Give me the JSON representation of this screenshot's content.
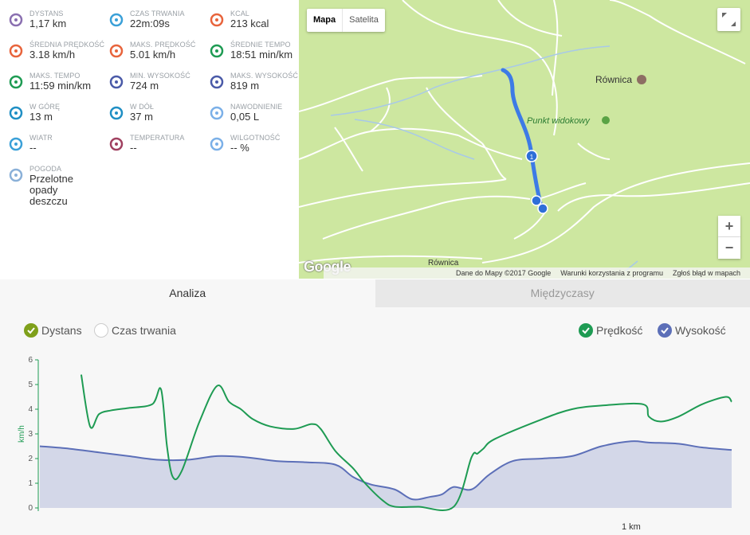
{
  "stats": [
    {
      "label": "DYSTANS",
      "value": "1,17 km",
      "icon": "distance-pin-icon"
    },
    {
      "label": "CZAS TRWANIA",
      "value": "22m:09s",
      "icon": "stopwatch-icon"
    },
    {
      "label": "KCAL",
      "value": "213 kcal",
      "icon": "flame-icon"
    },
    {
      "label": "ŚREDNIA PRĘDKOŚĆ",
      "value": "3.18 km/h",
      "icon": "speedometer-icon"
    },
    {
      "label": "MAKS. PRĘDKOŚĆ",
      "value": "5.01 km/h",
      "icon": "speedometer-max-icon"
    },
    {
      "label": "ŚREDNIE TEMPO",
      "value": "18:51 min/km",
      "icon": "pace-icon"
    },
    {
      "label": "MAKS. TEMPO",
      "value": "11:59 min/km",
      "icon": "pace-max-icon"
    },
    {
      "label": "MIN. WYSOKOŚĆ",
      "value": "724 m",
      "icon": "mountain-min-icon"
    },
    {
      "label": "MAKS. WYSOKOŚĆ",
      "value": "819 m",
      "icon": "mountain-max-icon"
    },
    {
      "label": "W GÓRĘ",
      "value": "13 m",
      "icon": "ascent-icon"
    },
    {
      "label": "W DÓŁ",
      "value": "37 m",
      "icon": "descent-icon"
    },
    {
      "label": "NAWODNIENIE",
      "value": "0,05 L",
      "icon": "water-drops-icon"
    },
    {
      "label": "WIATR",
      "value": "--",
      "icon": "wind-icon"
    },
    {
      "label": "TEMPERATURA",
      "value": "--",
      "icon": "thermometer-icon"
    },
    {
      "label": "WILGOTNOŚĆ",
      "value": "-- %",
      "icon": "humidity-icon"
    },
    {
      "label": "POGODA",
      "value": "Przelotne opady deszczu",
      "icon": "rain-cloud-icon"
    }
  ],
  "map": {
    "type_map": "Mapa",
    "type_satellite": "Satelita",
    "place_1": "Równica",
    "place_2": "Punkt widokowy",
    "place_3": "Równica",
    "marker_label": "1",
    "zoom_in": "+",
    "zoom_out": "−",
    "logo": "Google",
    "footer_data": "Dane do Mapy ©2017 Google",
    "footer_terms": "Warunki korzystania z programu",
    "footer_report": "Zgłoś błąd w mapach"
  },
  "tabs": {
    "analysis": "Analiza",
    "splits": "Międzyczasy"
  },
  "legend": {
    "distance": "Dystans",
    "duration": "Czas trwania",
    "speed": "Prędkość",
    "elevation": "Wysokość"
  },
  "colors": {
    "speed": "#1e9b53",
    "elevation": "#5c6fb8",
    "elevation_fill": "#d3d7e8",
    "route": "#3d7be6"
  },
  "chart_data": {
    "type": "line",
    "ylabel": "km/h",
    "ylim": [
      0,
      6
    ],
    "yticks": [
      "0",
      "1",
      "2",
      "3",
      "4",
      "5",
      "6"
    ],
    "x_tick": {
      "value": 1.0,
      "label": "1 km"
    },
    "xlim": [
      0,
      1.17
    ],
    "series": [
      {
        "name": "Prędkość",
        "x": [
          0.07,
          0.085,
          0.1,
          0.12,
          0.15,
          0.19,
          0.205,
          0.215,
          0.225,
          0.24,
          0.27,
          0.3,
          0.32,
          0.34,
          0.36,
          0.39,
          0.43,
          0.46,
          0.475,
          0.5,
          0.53,
          0.55,
          0.58,
          0.6,
          0.64,
          0.7,
          0.73,
          0.74,
          0.75,
          0.77,
          0.85,
          0.9,
          0.95,
          1.02,
          1.03,
          1.05,
          1.08,
          1.12,
          1.16,
          1.17
        ],
        "values": [
          5.4,
          3.3,
          3.8,
          3.95,
          4.05,
          4.2,
          4.8,
          2.5,
          1.25,
          1.5,
          3.5,
          4.95,
          4.3,
          4.0,
          3.6,
          3.3,
          3.2,
          3.4,
          3.2,
          2.3,
          1.6,
          1.0,
          0.3,
          0.05,
          0.05,
          0.05,
          2.05,
          2.2,
          2.4,
          2.8,
          3.6,
          4.0,
          4.15,
          4.2,
          3.7,
          3.5,
          3.7,
          4.2,
          4.5,
          4.3
        ]
      },
      {
        "name": "Wysokość",
        "x": [
          0.0,
          0.05,
          0.1,
          0.15,
          0.2,
          0.25,
          0.3,
          0.35,
          0.4,
          0.45,
          0.5,
          0.53,
          0.56,
          0.6,
          0.63,
          0.66,
          0.68,
          0.7,
          0.73,
          0.76,
          0.8,
          0.85,
          0.9,
          0.95,
          1.0,
          1.03,
          1.08,
          1.12,
          1.17
        ],
        "values": [
          2.5,
          2.4,
          2.25,
          2.1,
          1.95,
          1.95,
          2.1,
          2.05,
          1.9,
          1.85,
          1.75,
          1.25,
          0.95,
          0.75,
          0.35,
          0.45,
          0.55,
          0.85,
          0.75,
          1.35,
          1.9,
          2.0,
          2.1,
          2.5,
          2.7,
          2.65,
          2.6,
          2.45,
          2.35
        ]
      }
    ],
    "grid": false,
    "legend_position": "top"
  }
}
